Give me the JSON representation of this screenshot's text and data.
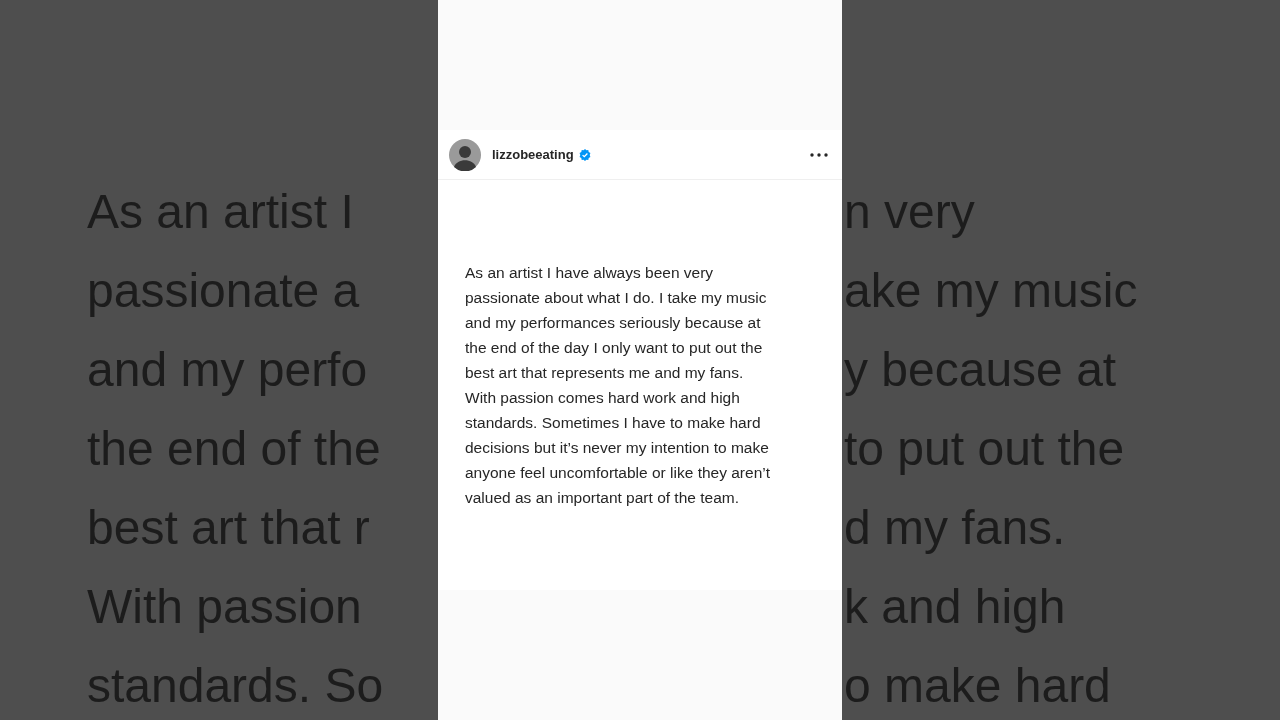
{
  "background_text": {
    "left_fragments": [
      "As an artist I",
      "passionate a",
      "and my perfo",
      "the end of the",
      "best art that r",
      "With passion",
      "standards. So"
    ],
    "right_fragments": [
      "n very",
      "ake my music",
      "y because at",
      "to put out the",
      "d my fans.",
      "k and high",
      "o make hard"
    ]
  },
  "post": {
    "username": "lizzobeeating",
    "verified": true,
    "text_lines": [
      "As an artist I have always been very",
      "passionate about what I do. I take my music",
      "and my performances seriously because at",
      "the end of the day I only want to put out the",
      "best art that represents me and my fans.",
      "With passion comes hard work and high",
      "standards. Sometimes I have to make hard",
      "decisions but it’s never my intention to make",
      "anyone feel uncomfortable or like they aren’t",
      "valued as an important part of the team."
    ]
  }
}
